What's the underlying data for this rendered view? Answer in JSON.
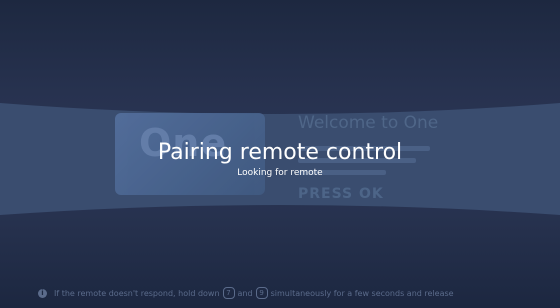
{
  "background_welcome": {
    "logo_text": "One",
    "title": "Welcome to One",
    "press_label": "PRESS OK"
  },
  "pairing": {
    "title": "Pairing remote control",
    "status": "Looking for remote"
  },
  "footer": {
    "icon": "info-icon",
    "text_before": "If the remote doesn't respond, hold down",
    "key_1": "7",
    "text_and": "and",
    "key_2": "9",
    "text_after": "simultaneously for a few seconds and release"
  },
  "colors": {
    "background": "#27324f",
    "band": "#3a4d6f",
    "text": "#ffffff",
    "footer_text": "#5b6b8b"
  }
}
